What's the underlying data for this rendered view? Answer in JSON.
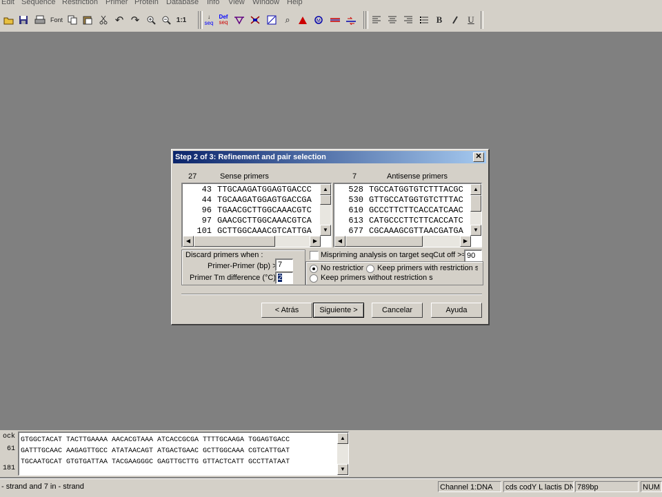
{
  "menu": [
    "Edit",
    "Sequence",
    "Restriction",
    "Primer",
    "Protein",
    "Database",
    "Info",
    "View",
    "Window",
    "Help"
  ],
  "toolbar": {
    "icons": [
      "open-icon",
      "save-icon",
      "print-icon",
      "font-icon",
      "copy-icon",
      "paste-icon",
      "cut-icon",
      "undo-icon",
      "redo-icon",
      "zoom-in-icon",
      "zoom-out-icon",
      "zoom-reset-icon",
      "sequence-icon",
      "define-sequence-icon",
      "restriction-map-icon",
      "restriction-digest-icon",
      "dotplot-icon",
      "find-icon",
      "align-icon",
      "orf-icon",
      "translate-icon",
      "primer-icon",
      "align-left-icon",
      "align-center-icon",
      "align-right-icon",
      "list-icon",
      "bold-icon",
      "italic-icon",
      "underline-icon"
    ],
    "font_label": "Font",
    "seq_label": "seq",
    "def_label": "Def",
    "defseq_label": "seq",
    "zoom_label": "1:1",
    "bold_label": "B",
    "underline_label": "U"
  },
  "dialog": {
    "title": "Step 2 of 3: Refinement and pair selection",
    "close_label": "✕",
    "sense": {
      "count": "27",
      "header": "Sense primers",
      "rows": [
        {
          "pos": "43",
          "seq": "TTGCAAGATGGAGTGACCC"
        },
        {
          "pos": "44",
          "seq": "TGCAAGATGGAGTGACCGA"
        },
        {
          "pos": "96",
          "seq": "TGAACGCTTGGCAAACGTC"
        },
        {
          "pos": "97",
          "seq": "GAACGCTTGGCAAACGTCA"
        },
        {
          "pos": "101",
          "seq": "GCTTGGCAAACGTCATTGA"
        }
      ]
    },
    "antisense": {
      "count": "7",
      "header": "Antisense primers",
      "rows": [
        {
          "pos": "528",
          "seq": "TGCCATGGTGTCTTTACGC"
        },
        {
          "pos": "530",
          "seq": "GTTGCCATGGTGTCTTTAC"
        },
        {
          "pos": "610",
          "seq": "GCCCTTCTTCACCATCAAC"
        },
        {
          "pos": "613",
          "seq": "CATGCCCTTCTTCACCATC"
        },
        {
          "pos": "677",
          "seq": "CGCAAAGCGTTAACGATGA"
        }
      ]
    },
    "discard": {
      "label": "Discard primers when :",
      "primer_primer_label": "Primer-Primer (bp) >",
      "primer_primer_value": "7",
      "tm_label": "Primer Tm difference (°C)",
      "tm_value": "2"
    },
    "mispriming": {
      "label": "Mispriming analysis on target seq",
      "checked": false,
      "cutoff_label": "Cut off >=",
      "cutoff_value": "90"
    },
    "restriction": {
      "options": [
        "No restrictior",
        "Keep primers with restriction sit",
        "Keep primers without restriction site"
      ],
      "selected": 0
    },
    "buttons": {
      "back": "< Atrás",
      "next": "Siguiente >",
      "cancel": "Cancelar",
      "help": "Ayuda"
    }
  },
  "sequence_panel": {
    "ruler": [
      "ock",
      "61",
      "181"
    ],
    "lines": [
      "GTGGCTACAT TACTTGAAAA AACACGTAAA ATCACCGCGA TTTTGCAAGA TGGAGTGACC",
      "GATTTGCAAC AAGAGTTGCC ATATAACAGT ATGACTGAAC GCTTGGCAAA CGTCATTGAT",
      "TGCAATGCAT GTGTGATTAA TACGAAGGGC GAGTTGCTTG GTTACTCATT GCCTTATAAT"
    ]
  },
  "status": {
    "message": "- strand and 7 in - strand",
    "channel": "Channel 1:DNA",
    "sequence_name": "cds codY L lactis DNA",
    "length": "789bp",
    "numlock": "NUM"
  }
}
